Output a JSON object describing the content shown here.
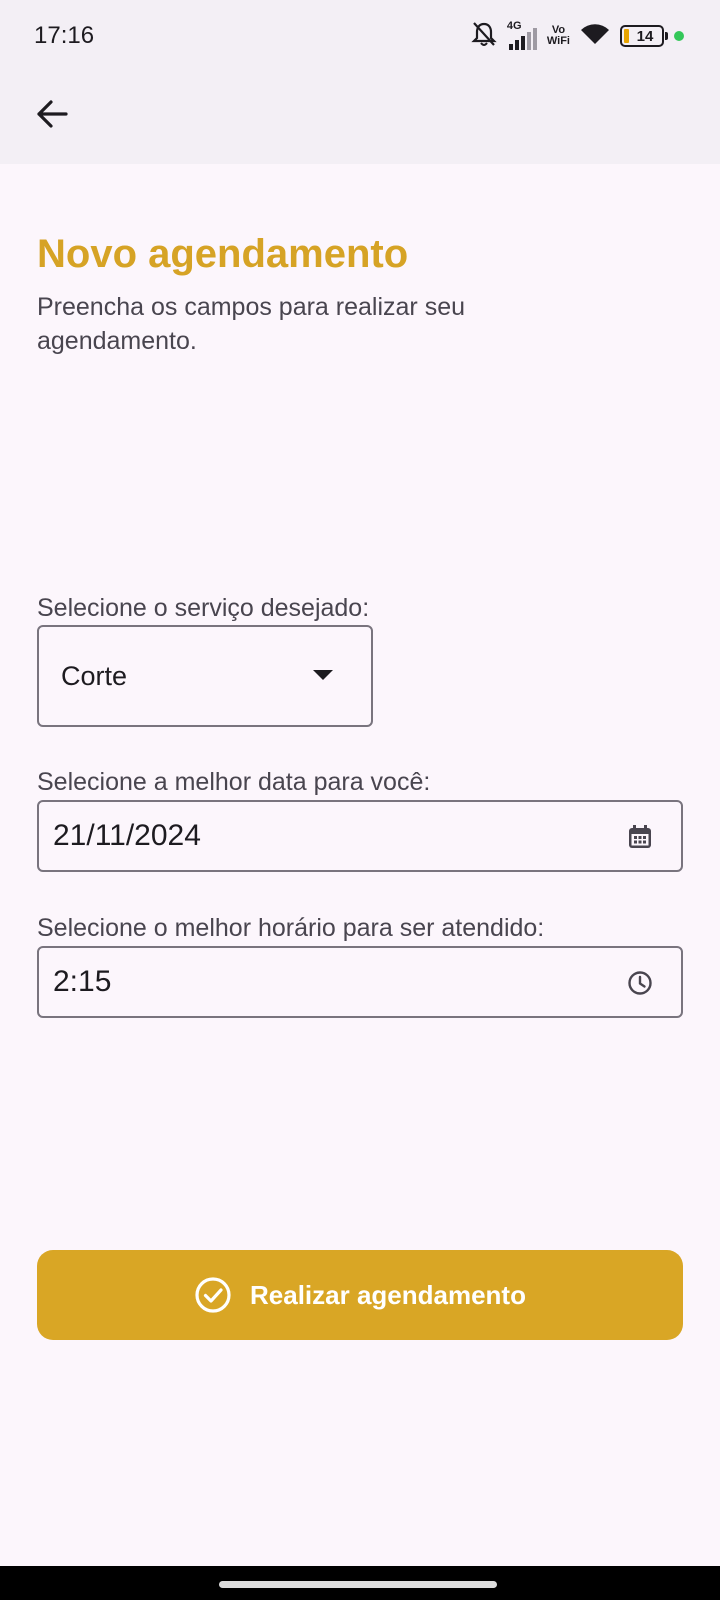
{
  "status_bar": {
    "time": "17:16",
    "network": "4G",
    "volte_top": "Vo",
    "volte_bottom": "WiFi",
    "battery": "14"
  },
  "header": {
    "title": "Novo agendamento",
    "subtitle": "Preencha os campos para realizar seu agendamento."
  },
  "form": {
    "service_label": "Selecione o serviço desejado:",
    "service_value": "Corte",
    "date_label": "Selecione a melhor data para você:",
    "date_value": "21/11/2024",
    "time_label": "Selecione o melhor horário para ser atendido:",
    "time_value": "2:15"
  },
  "cta": {
    "label": "Realizar agendamento",
    "color": "#d9a625"
  },
  "colors": {
    "accent": "#d6a325",
    "background": "#fcf6fc"
  }
}
